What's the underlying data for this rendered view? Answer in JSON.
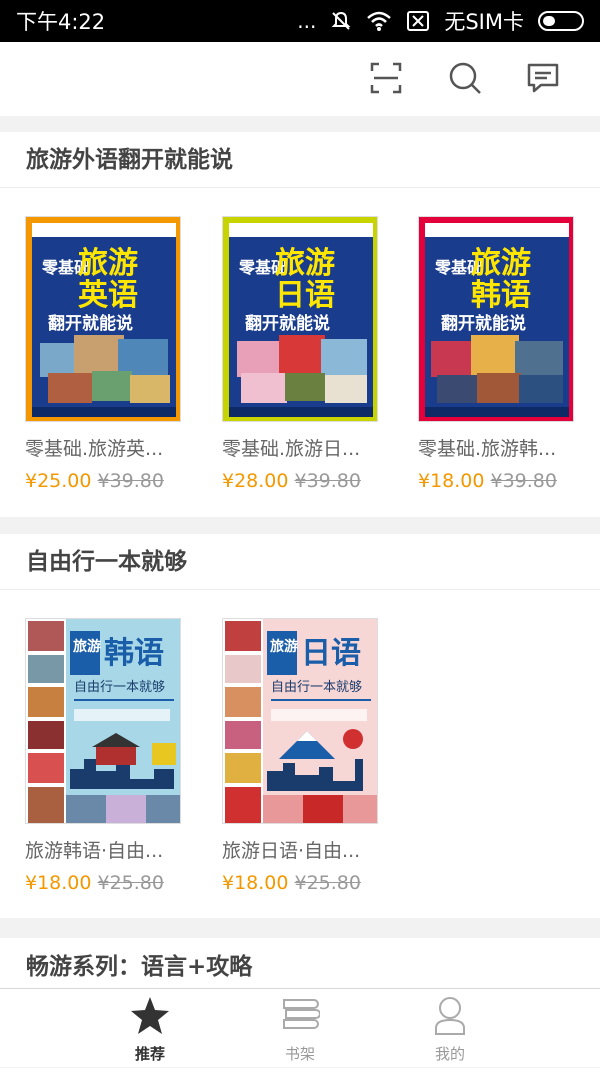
{
  "status_bar": {
    "time": "下午4:22",
    "dots": "...",
    "sim": "无SIM卡"
  },
  "toolbar": {
    "icons": [
      "scan-icon",
      "search-icon",
      "message-icon"
    ]
  },
  "sections": [
    {
      "title": "旅游外语翻开就能说",
      "books": [
        {
          "title": "零基础.旅游英...",
          "price": "¥25.00",
          "original_price": "¥39.80",
          "cover": {
            "frame": "#f39800",
            "bg": "#1a3c8c",
            "line1": "零基础",
            "line2": "旅游",
            "line3": "英语",
            "subtitle": "翻开就能说"
          }
        },
        {
          "title": "零基础.旅游日...",
          "price": "¥28.00",
          "original_price": "¥39.80",
          "cover": {
            "frame": "#c8d400",
            "bg": "#1a3c8c",
            "line1": "零基础",
            "line2": "旅游",
            "line3": "日语",
            "subtitle": "翻开就能说"
          }
        },
        {
          "title": "零基础.旅游韩...",
          "price": "¥18.00",
          "original_price": "¥39.80",
          "cover": {
            "frame": "#e4003a",
            "bg": "#1a3c8c",
            "line1": "零基础",
            "line2": "旅游",
            "line3": "韩语",
            "subtitle": "翻开就能说"
          }
        }
      ]
    },
    {
      "title": "自由行一本就够",
      "books": [
        {
          "title": "旅游韩语·自由...",
          "price": "¥18.00",
          "original_price": "¥25.80",
          "cover": {
            "bg": "#a8d8e8",
            "accent": "#1a5da8",
            "tag": "旅游",
            "main": "韩语",
            "subtitle": "自由行一本就够"
          }
        },
        {
          "title": "旅游日语·自由...",
          "price": "¥18.00",
          "original_price": "¥25.80",
          "cover": {
            "bg": "#f7d6d6",
            "accent": "#1a5da8",
            "tag": "旅游",
            "main": "日语",
            "subtitle": "自由行一本就够"
          }
        }
      ]
    },
    {
      "title": "畅游系列：语言+攻略"
    }
  ],
  "tabbar": {
    "tabs": [
      {
        "label": "推荐",
        "icon": "star-icon",
        "active": true
      },
      {
        "label": "书架",
        "icon": "bookshelf-icon",
        "active": false
      },
      {
        "label": "我的",
        "icon": "person-icon",
        "active": false
      }
    ]
  },
  "colors": {
    "price": "#f39800",
    "accent": "#f39800"
  }
}
